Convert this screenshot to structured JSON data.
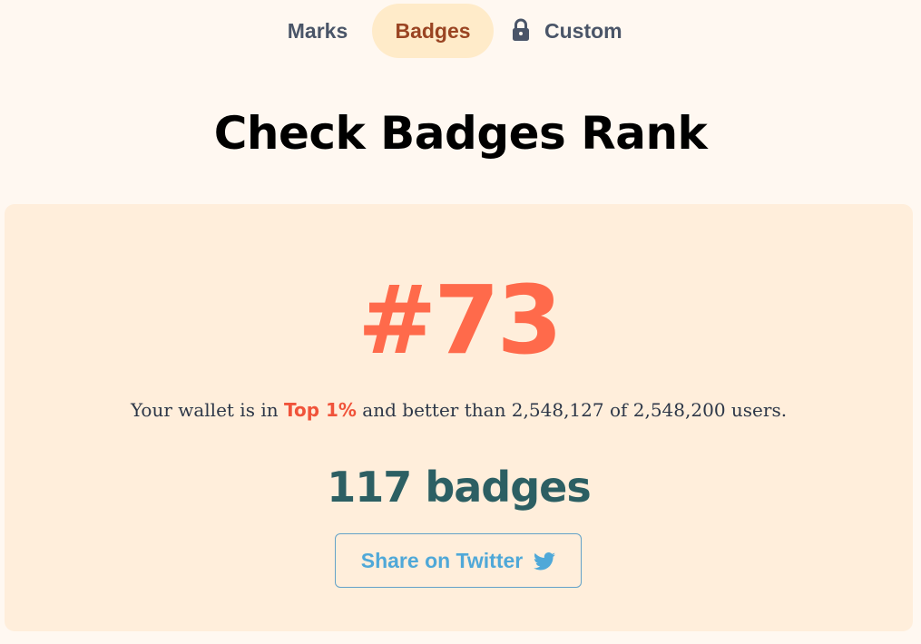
{
  "tabs": [
    {
      "label": "Marks",
      "active": false,
      "locked": false
    },
    {
      "label": "Badges",
      "active": true,
      "locked": false
    },
    {
      "label": "Custom",
      "active": false,
      "locked": true
    }
  ],
  "page": {
    "title": "Check Badges Rank"
  },
  "rank": {
    "number": "#73",
    "summary_prefix": "Your wallet is in ",
    "top_percent": "Top 1%",
    "summary_suffix": " and better than 2,548,127 of 2,548,200 users.",
    "badge_count": "117 badges"
  },
  "share": {
    "label": "Share on Twitter",
    "icon": "twitter-icon"
  },
  "colors": {
    "background": "#fff8f1",
    "card": "#ffeedb",
    "accent": "#ff6a4b",
    "active_tab_bg": "#ffebc9",
    "active_tab_text": "#9a4422",
    "badge_count": "#2c5f63",
    "twitter": "#4fa8d8"
  }
}
